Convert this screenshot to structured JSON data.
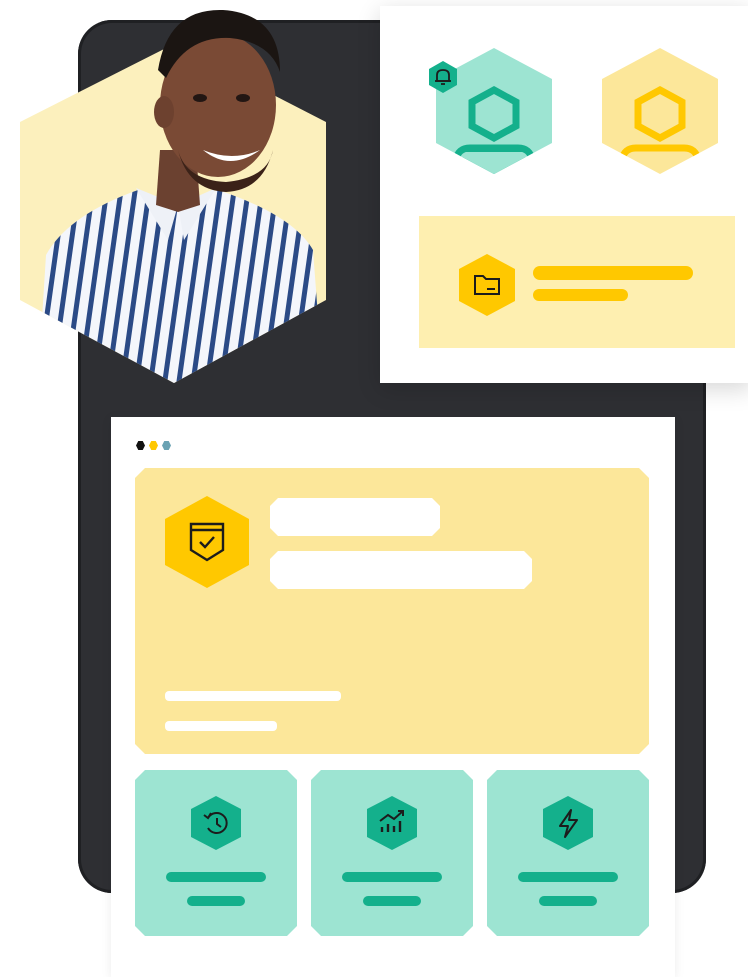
{
  "illustration": {
    "colors": {
      "device": "#2e2f33",
      "yellow_light": "#fce79a",
      "yellow_pale": "#feefb0",
      "yellow_accent": "#ffc800",
      "mint": "#9de4d2",
      "teal": "#14b08c",
      "white": "#ffffff"
    },
    "person_photo": {
      "alt": ""
    },
    "profile_card": {
      "avatars": [
        {
          "icon": "user-avatar-icon",
          "color": "#9de4d2",
          "badge": "bell-icon"
        },
        {
          "icon": "user-avatar-icon",
          "color": "#fce79a"
        }
      ],
      "folder_item": {
        "icon": "folder-icon"
      }
    },
    "dashboard": {
      "window_dots": [
        "#111111",
        "#ffc800",
        "#6aa2b3"
      ],
      "hero_icon": "badge-check-icon",
      "feature_tiles": [
        {
          "icon": "history-icon"
        },
        {
          "icon": "analytics-chart-icon"
        },
        {
          "icon": "lightning-icon"
        }
      ]
    }
  }
}
